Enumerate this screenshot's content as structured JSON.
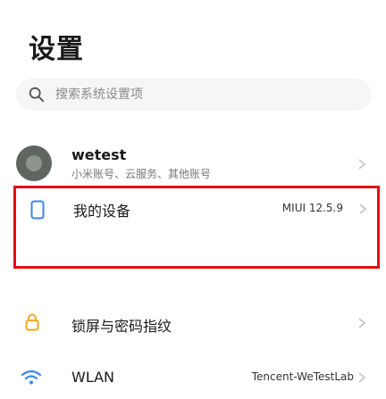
{
  "page": {
    "title": "设置"
  },
  "search": {
    "icon": "search-icon",
    "placeholder": "搜索系统设置项"
  },
  "account": {
    "name": "wetest",
    "subtitle": "小米账号、云服务、其他账号"
  },
  "settings": {
    "about_phone": {
      "icon": "phone-icon",
      "label": "我的设备",
      "value": "MIUI 12.5.9"
    },
    "lock_screen": {
      "icon": "lock-icon",
      "label": "锁屏与密码指纹"
    },
    "wlan": {
      "icon": "wifi-icon",
      "label": "WLAN",
      "value": "Tencent-WeTestLab"
    }
  },
  "colors": {
    "highlight_border": "#e0101a",
    "icon_accent": "#3a86f4",
    "lock_icon": "#f5a623"
  }
}
